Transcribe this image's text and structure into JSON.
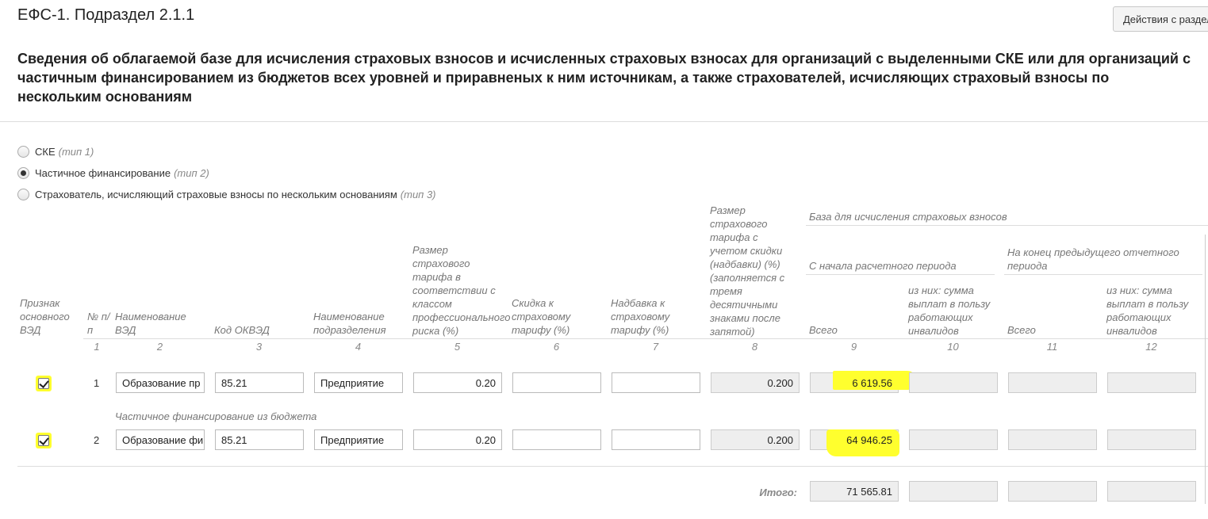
{
  "page_title": "ЕФС-1. Подраздел 2.1.1",
  "actions_button": "Действия с разделом",
  "heading_lines": [
    "Сведения об облагаемой базе для исчисления страховых взносов и исчисленных страховых взносах для организаций с выделенными СКЕ или для организаций с",
    "частичным финансированием из бюджетов всех уровней и приравненых к ним источникам, а также страхователей, исчисляющих страховый взносы по",
    "нескольким основаниям"
  ],
  "radio_options": [
    {
      "label": "СКЕ",
      "sub": "(тип 1)",
      "checked": false
    },
    {
      "label": "Частичное финансирование",
      "sub": "(тип 2)",
      "checked": true
    },
    {
      "label": "Страхователь, исчисляющий страховые взносы по нескольким основаниям",
      "sub": "(тип 3)",
      "checked": false
    }
  ],
  "table": {
    "group_header": "База для исчисления страховых взносов",
    "subgroup_start": "С начала расчетного периода",
    "subgroup_prev": "На конец предыдущего отчетного периода",
    "columns": [
      "Признак основного ВЭД",
      "№ п/п",
      "Наименование ВЭД",
      "Код ОКВЭД",
      "Наименование подразделения",
      "Размер страхового тарифа в соответствии с классом профессионального риска (%)",
      "Скидка к страховому тарифу (%)",
      "Надбавка к страховому тарифу (%)",
      "Размер страхового тарифа с учетом скидки (надбавки) (%) (заполняется с тремя десятичными знаками после запятой)",
      "Всего",
      "из них: сумма выплат в пользу работающих инвалидов",
      "Всего",
      "из них: сумма выплат в пользу работающих инвалидов"
    ],
    "column_numbers": [
      "1",
      "2",
      "3",
      "4",
      "5",
      "6",
      "7",
      "8",
      "9",
      "10",
      "11",
      "12"
    ],
    "rows": [
      {
        "checked": true,
        "num": "1",
        "ved_name": "Образование пр",
        "okved": "85.21",
        "division": "Предприятие",
        "tariff": "0.20",
        "discount": "",
        "surcharge": "",
        "tariff_adj": "0.200",
        "total_start": "6 619.56",
        "disabled_start": "",
        "total_prev": "",
        "disabled_prev": ""
      },
      {
        "checked": true,
        "num": "2",
        "ved_name": "Образование фи",
        "okved": "85.21",
        "division": "Предприятие",
        "tariff": "0.20",
        "discount": "",
        "surcharge": "",
        "tariff_adj": "0.200",
        "total_start": "64 946.25",
        "disabled_start": "",
        "total_prev": "",
        "disabled_prev": ""
      }
    ],
    "sub_caption": "Частичное финансирование из бюджета",
    "total_label": "Итого:",
    "totals": {
      "total_start": "71 565.81",
      "disabled_start": "",
      "total_prev": "",
      "disabled_prev": ""
    }
  },
  "colors": {
    "highlight": "#ffff2e",
    "readonly_bg": "#eeeeee"
  }
}
